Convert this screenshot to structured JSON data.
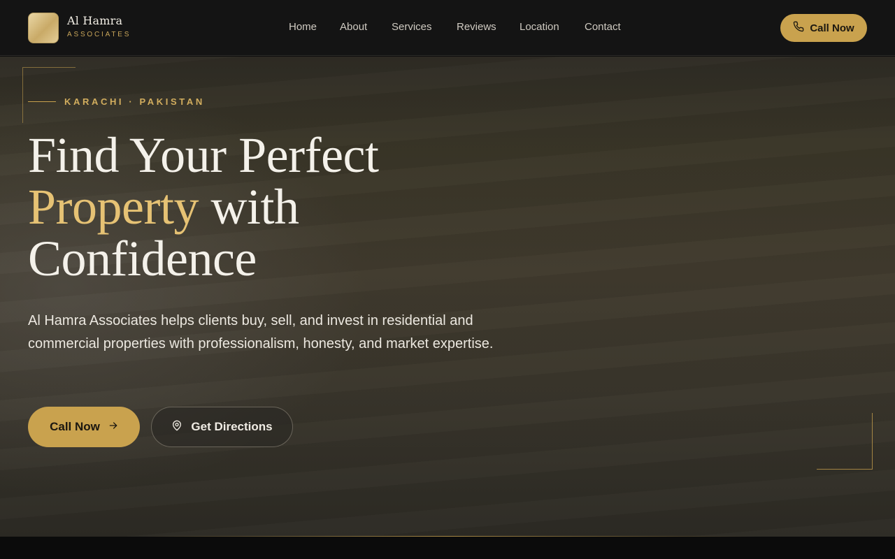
{
  "brand": {
    "name": "Al Hamra",
    "tagline": "ASSOCIATES"
  },
  "nav": {
    "items": [
      {
        "label": "Home"
      },
      {
        "label": "About"
      },
      {
        "label": "Services"
      },
      {
        "label": "Reviews"
      },
      {
        "label": "Location"
      },
      {
        "label": "Contact"
      }
    ]
  },
  "header": {
    "call_label": "Call Now"
  },
  "hero": {
    "eyebrow": "KARACHI · PAKISTAN",
    "headline_line1": "Find Your Perfect",
    "headline_accent": "Property",
    "headline_line2_rest": " with",
    "headline_line3": "Confidence",
    "description": "Al Hamra Associates helps clients buy, sell, and invest in residential and commercial properties with professionalism, honesty, and market expertise.",
    "primary_cta": "Call Now",
    "secondary_cta": "Get Directions"
  },
  "icons": {
    "header_call": "phone-icon",
    "primary_cta": "arrow-right-icon",
    "secondary_cta": "map-pin-icon"
  },
  "colors": {
    "accent": "#c9a24e",
    "accent_text": "#e6c274",
    "header_bg": "#141414"
  }
}
